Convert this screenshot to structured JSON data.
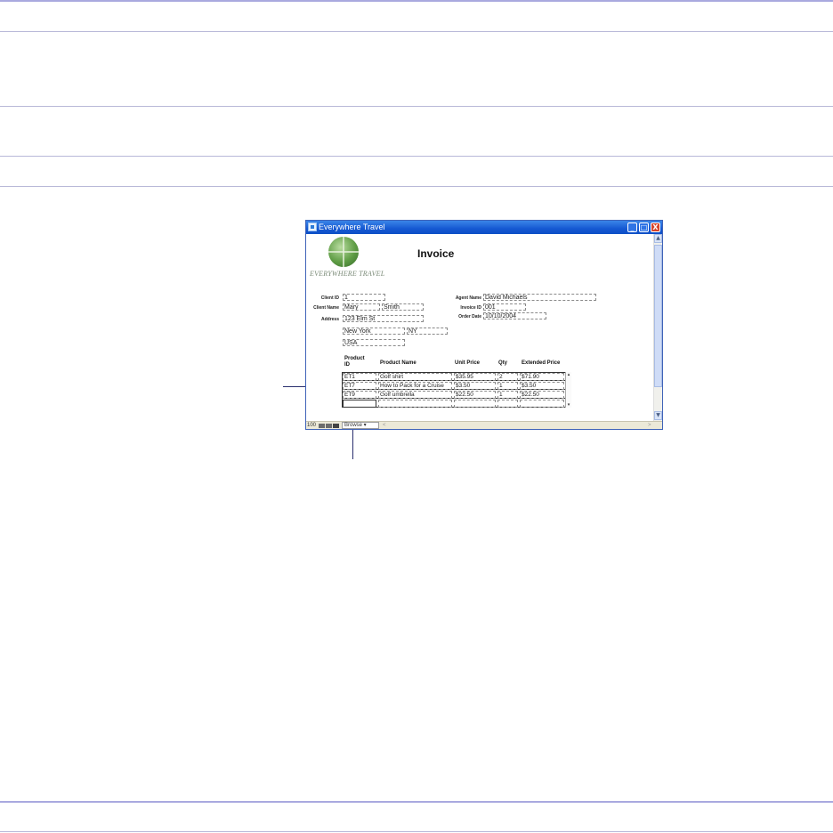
{
  "window": {
    "title": "Everywhere Travel",
    "controls": {
      "minimize": "_",
      "maximize": "□",
      "close": "X"
    }
  },
  "logo": {
    "brand_text": "EVERYWHERE TRAVEL"
  },
  "invoice": {
    "title": "Invoice",
    "client_id_label": "Client ID",
    "client_id": "1",
    "client_name_label": "Client Name",
    "first_name": "Mary",
    "last_name": "Smith",
    "address_label": "Address",
    "street": "123 Elm St",
    "city": "New York",
    "state": "NY",
    "country": "USA",
    "agent_name_label": "Agent Name",
    "agent_name": "David Michaels",
    "invoice_id_label": "Invoice ID",
    "invoice_id": "001",
    "order_date_label": "Order Date",
    "order_date": "10/10/2004"
  },
  "line_items": {
    "headers": {
      "product_id": "Product ID",
      "product_name": "Product Name",
      "unit_price": "Unit Price",
      "qty": "Qty",
      "extended_price": "Extended Price"
    },
    "rows": [
      {
        "product_id": "ET1",
        "product_name": "Golf shirt",
        "unit_price": "$35.95",
        "qty": "2",
        "extended_price": "$71.90"
      },
      {
        "product_id": "ET7",
        "product_name": "How to Pack for a Cruise",
        "unit_price": "$3.50",
        "qty": "1",
        "extended_price": "$3.50"
      },
      {
        "product_id": "ET9",
        "product_name": "Golf umbrella",
        "unit_price": "$22.50",
        "qty": "1",
        "extended_price": "$22.50"
      }
    ]
  },
  "status_bar": {
    "zoom": "100",
    "mode": "Browse"
  },
  "colors": {
    "titlebar": "#1558d2",
    "close_button": "#d5442b",
    "callout": "#2a2f6e"
  }
}
